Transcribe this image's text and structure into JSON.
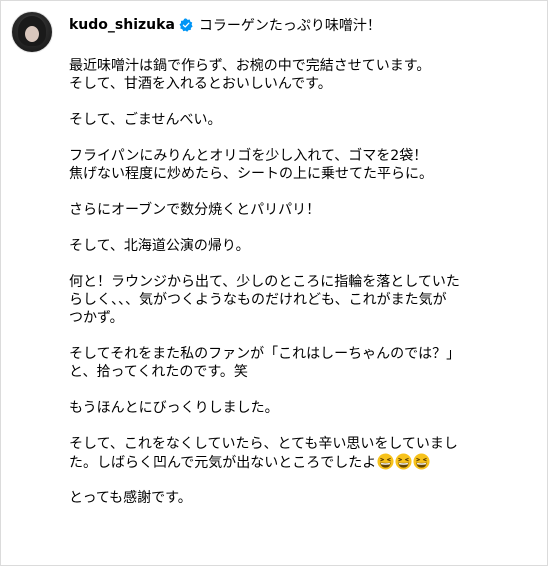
{
  "post": {
    "username": "kudo_shizuka",
    "title": "コラーゲンたっぷり味噌汁！",
    "paragraphs": [
      [
        "最近味噌汁は鍋で作らず、お椀の中で完結させています。",
        "そして、甘酒を入れるとおいしいんです。"
      ],
      [
        "そして、ごませんべい。"
      ],
      [
        "フライパンにみりんとオリゴを少し入れて、ゴマを2袋！",
        "焦げない程度に炒めたら、シートの上に乗せてた平らに。"
      ],
      [
        "さらにオーブンで数分焼くとパリパリ！"
      ],
      [
        "そして、北海道公演の帰り。"
      ],
      [
        "何と！ラウンジから出て、少しのところに指輪を落としていた",
        "らしく、、、気がつくようなものだけれども、これがまた気が",
        "つかず。"
      ],
      [
        "そしてそれをまた私のファンが「これはしーちゃんのでは？」",
        "と、拾ってくれたのです。笑"
      ],
      [
        "もうほんとにびっくりしました。"
      ],
      [
        "そして、これをなくしていたら、とても辛い思いをしていまし",
        "た。しばらく凹んで元気が出ないところでしたよ"
      ],
      [
        "とっても感謝です。"
      ]
    ],
    "emojis": [
      "grinning-squinting-face",
      "grinning-squinting-face",
      "grinning-squinting-face"
    ],
    "verified_color": "#0095f6",
    "emoji_color": "#f7c21b"
  }
}
